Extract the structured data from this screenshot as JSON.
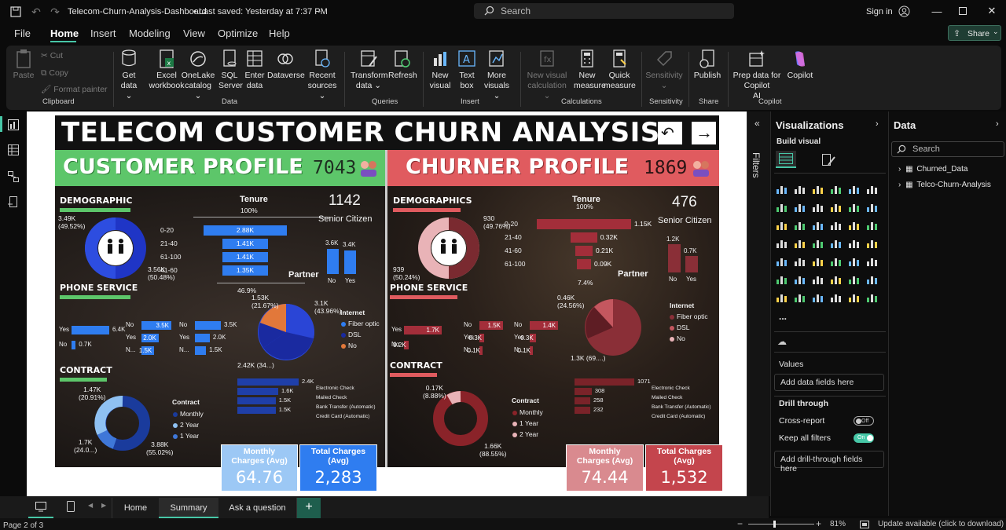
{
  "titlebar": {
    "file_title": "Telecom-Churn-Analysis-Dashboard",
    "saved_status": "• Last saved: Yesterday at 7:37 PM",
    "search_placeholder": "Search",
    "signin": "Sign in"
  },
  "menu": {
    "items": [
      "File",
      "Home",
      "Insert",
      "Modeling",
      "View",
      "Optimize",
      "Help"
    ],
    "active": "Home",
    "share": "Share"
  },
  "ribbon": {
    "clipboard": {
      "paste": "Paste",
      "cut": "Cut",
      "copy": "Copy",
      "format_painter": "Format painter",
      "group": "Clipboard"
    },
    "data": {
      "get_data": [
        "Get",
        "data ⌄"
      ],
      "excel": [
        "Excel",
        "workbook"
      ],
      "onelake": [
        "OneLake",
        "catalog ⌄"
      ],
      "sql": [
        "SQL",
        "Server"
      ],
      "enter": [
        "Enter",
        "data"
      ],
      "dataverse": [
        "Dataverse",
        ""
      ],
      "recent": [
        "Recent",
        "sources ⌄"
      ],
      "group": "Data"
    },
    "queries": {
      "transform": [
        "Transform",
        "data ⌄"
      ],
      "refresh": [
        "Refresh",
        ""
      ],
      "group": "Queries"
    },
    "insert": {
      "new_visual": [
        "New",
        "visual"
      ],
      "text_box": [
        "Text",
        "box"
      ],
      "more_visuals": [
        "More",
        "visuals ⌄"
      ],
      "group": "Insert"
    },
    "calculations": {
      "new_visual_calc": [
        "New visual",
        "calculation ⌄"
      ],
      "new_measure": [
        "New",
        "measure"
      ],
      "quick_measure": [
        "Quick",
        "measure"
      ],
      "group": "Calculations"
    },
    "sensitivity": {
      "label": [
        "Sensitivity",
        "⌄"
      ],
      "group": "Sensitivity"
    },
    "share": {
      "publish": [
        "Publish",
        ""
      ],
      "group": "Share"
    },
    "copilot": {
      "prep": [
        "Prep data for Copilot",
        "AI"
      ],
      "copilot": [
        "Copilot",
        ""
      ],
      "group": "Copilot"
    }
  },
  "report": {
    "title": "TELECOM CUSTOMER CHURN ANALYSIS",
    "customer_profile": {
      "heading": "CUSTOMER PROFILE",
      "total": "7043",
      "demographic_title": "DEMOGRAPHIC",
      "demo_top": "3.49K\n(49.52%)",
      "demo_bottom": "3.56K\n(50.48%)",
      "tenure_title": "Tenure",
      "tenure_pct_top": "100%",
      "tenure_pct_bottom": "46.9%",
      "tenure_rows": [
        {
          "label": "0-20",
          "value": "2.88K"
        },
        {
          "label": "21-40",
          "value": "1.41K"
        },
        {
          "label": "61-100",
          "value": "1.41K"
        },
        {
          "label": "41-60",
          "value": "1.35K"
        }
      ],
      "senior_count": "1142",
      "senior_label": "Senior Citizen",
      "partner_title": "Partner",
      "partner": [
        {
          "label": "No",
          "value": "3.6K"
        },
        {
          "label": "Yes",
          "value": "3.4K"
        }
      ],
      "phone_title": "PHONE SERVICE",
      "phone_bars": [
        {
          "label": "Yes",
          "value": "6.4K"
        },
        {
          "label": "No",
          "value": "0.7K"
        }
      ],
      "multi_a": [
        {
          "label": "No",
          "value": "3.5K"
        },
        {
          "label": "Yes",
          "value": "2.0K"
        },
        {
          "label": "N...",
          "value": "1.5K"
        }
      ],
      "multi_b": [
        {
          "label": "No",
          "value": "3.5K"
        },
        {
          "label": "Yes",
          "value": "2.0K"
        },
        {
          "label": "N...",
          "value": "1.5K"
        }
      ],
      "internet_title": "Internet",
      "internet_legend": [
        "Fiber optic",
        "DSL",
        "No"
      ],
      "internet_labels": {
        "top": "1.53K\n(21.67%)",
        "right": "3.1K\n(43.96%)",
        "bottom": "2.42K (34...)"
      },
      "contract_title": "CONTRACT",
      "contract_legend_title": "Contract",
      "contract_legend": [
        "Monthly",
        "2 Year",
        "1 Year"
      ],
      "contract_labels": {
        "top": "1.47K\n(20.91%)",
        "left": "1.7K\n(24.0...)",
        "right": "3.88K\n(55.02%)"
      },
      "payment": [
        {
          "label": "Electronic Check",
          "value": "2.4K"
        },
        {
          "label": "Mailed Check",
          "value": "1.6K"
        },
        {
          "label": "Bank Transfer (Automatic)",
          "value": "1.5K"
        },
        {
          "label": "Credit Card (Automatic)",
          "value": "1.5K"
        }
      ],
      "monthly_label": "Monthly\nCharges (Avg)",
      "monthly_value": "64.76",
      "total_label": "Total Charges\n(Avg)",
      "total_value": "2,283"
    },
    "churner_profile": {
      "heading": "CHURNER PROFILE",
      "total": "1869",
      "demographic_title": "DEMOGRAPHICS",
      "demo_top": "930\n(49.76%)",
      "demo_bottom": "939\n(50.24%)",
      "tenure_title": "Tenure",
      "tenure_pct_top": "100%",
      "tenure_pct_bottom": "7.4%",
      "tenure_rows": [
        {
          "label": "0-20",
          "value": "1.15K"
        },
        {
          "label": "21-40",
          "value": "0.32K"
        },
        {
          "label": "41-60",
          "value": "0.21K"
        },
        {
          "label": "61-100",
          "value": "0.09K"
        }
      ],
      "senior_count": "476",
      "senior_label": "Senior Citizen",
      "partner_title": "Partner",
      "partner": [
        {
          "label": "No",
          "value": "1.2K"
        },
        {
          "label": "Yes",
          "value": "0.7K"
        }
      ],
      "phone_title": "PHONE SERVICE",
      "phone_bars": [
        {
          "label": "Yes",
          "value": "1.7K"
        },
        {
          "label": "No",
          "value": "0.2K"
        }
      ],
      "multi_a": [
        {
          "label": "No",
          "value": "1.5K"
        },
        {
          "label": "Yes",
          "value": "0.3K"
        },
        {
          "label": "N...",
          "value": "0.1K"
        }
      ],
      "multi_b": [
        {
          "label": "No",
          "value": "1.4K"
        },
        {
          "label": "Yes",
          "value": "0.3K"
        },
        {
          "label": "N...",
          "value": "0.1K"
        }
      ],
      "internet_title": "Internet",
      "internet_legend": [
        "Fiber optic",
        "DSL",
        "No"
      ],
      "internet_labels": {
        "top": "0.46K\n(24.56%)",
        "bottom": "1.3K (69....)"
      },
      "contract_title": "CONTRACT",
      "contract_legend_title": "Contract",
      "contract_legend": [
        "Monthly",
        "1 Year",
        "2 Year"
      ],
      "contract_labels": {
        "top": "0.17K\n(8.88%)",
        "right": "1.66K\n(88.55%)"
      },
      "payment": [
        {
          "label": "Electronic Check",
          "value": "1071"
        },
        {
          "label": "Mailed Check",
          "value": "308"
        },
        {
          "label": "Bank Transfer (Automatic)",
          "value": "258"
        },
        {
          "label": "Credit Card (Automatic)",
          "value": "232"
        }
      ],
      "monthly_label": "Monthly\nCharges (Avg)",
      "monthly_value": "74.44",
      "total_label": "Total Charges\n(Avg)",
      "total_value": "1,532"
    }
  },
  "filters": {
    "label": "Filters"
  },
  "visualizations": {
    "title": "Visualizations",
    "build_visual": "Build visual",
    "values_label": "Values",
    "values_placeholder": "Add data fields here",
    "drill_title": "Drill through",
    "cross_report": "Cross-report",
    "cross_report_state": "Off",
    "keep_filters": "Keep all filters",
    "keep_filters_state": "On",
    "drill_placeholder": "Add drill-through fields here",
    "more": "..."
  },
  "data_pane": {
    "title": "Data",
    "search_placeholder": "Search",
    "tables": [
      "Churned_Data",
      "Telco-Churn-Analysis"
    ]
  },
  "pages": {
    "tabs": [
      "Home",
      "Summary",
      "Ask a question"
    ],
    "active": "Summary",
    "add": "+"
  },
  "status": {
    "page": "Page 2 of 3",
    "zoom": "81%",
    "update": "Update available (click to download)"
  },
  "colors": {
    "accent": "#47c7a7",
    "customer_green": "#5dc66a",
    "churner_red": "#e05b5f",
    "blue_bar": "#2f7df0",
    "red_bar": "#a32e3a"
  }
}
